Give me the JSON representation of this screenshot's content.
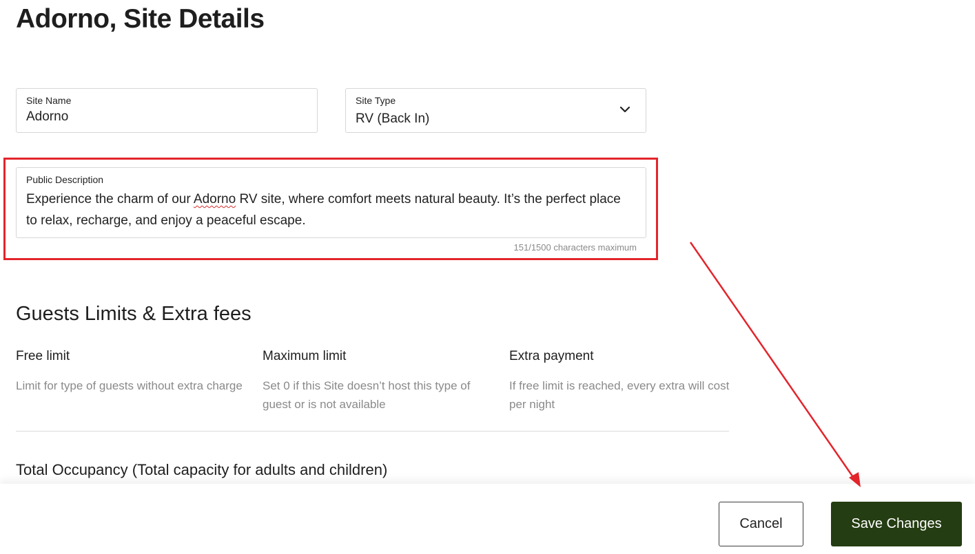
{
  "page": {
    "title": "Adorno, Site Details"
  },
  "site_name": {
    "label": "Site Name",
    "value": "Adorno"
  },
  "site_type": {
    "label": "Site Type",
    "value": "RV (Back In)",
    "icon": "chevron-down-icon"
  },
  "public_description": {
    "label": "Public Description",
    "text_before": "Experience the charm of our ",
    "misspelled_word": "Adorno",
    "text_after": " RV site, where comfort meets natural beauty. It’s the perfect place to relax, recharge, and enjoy a peaceful escape.",
    "char_count": "151/1500 characters maximum"
  },
  "guests_section": {
    "title": "Guests Limits & Extra fees",
    "columns": [
      {
        "title": "Free limit",
        "description": "Limit for type of guests without extra charge"
      },
      {
        "title": "Maximum limit",
        "description": "Set 0 if this Site doesn’t host this type of guest or is not available"
      },
      {
        "title": "Extra payment",
        "description": "If free limit is reached, every extra will cost per night"
      }
    ],
    "occupancy_title": "Total Occupancy (Total capacity for adults and children)"
  },
  "footer": {
    "cancel_label": "Cancel",
    "save_label": "Save Changes"
  },
  "colors": {
    "primary_button": "#243d12",
    "annotation_red": "#e3242b",
    "muted_text": "#8a8a8a"
  }
}
